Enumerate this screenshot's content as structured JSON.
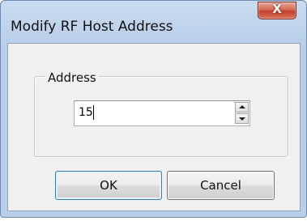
{
  "window": {
    "title": "Modify RF Host Address",
    "close_label": "X"
  },
  "address_group": {
    "label": "Address",
    "value": "15"
  },
  "buttons": {
    "ok_label": "OK",
    "cancel_label": "Cancel"
  },
  "colors": {
    "frame": "#b9cfe9",
    "close_button": "#c2402a",
    "client_background": "#f0f0f0"
  }
}
